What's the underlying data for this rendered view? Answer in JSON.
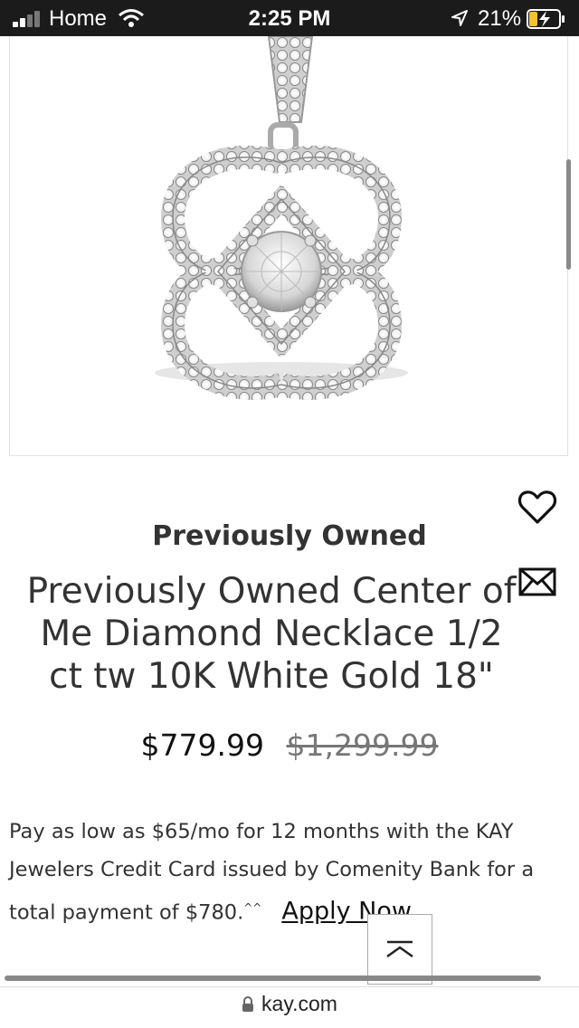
{
  "status_bar": {
    "carrier": "Home",
    "time": "2:25 PM",
    "battery": "21%"
  },
  "product": {
    "brand_label": "Previously Owned",
    "title": "Previously Owned Center of Me Diamond Necklace 1/2 ct tw 10K White Gold 18\"",
    "sale_price": "$779.99",
    "original_price": "$1,299.99",
    "finance_text": "Pay as low as $65/mo for 12 months with the KAY Jewelers Credit Card issued by Comenity Bank for a total payment of $780.",
    "finance_sup": "^^",
    "apply_label": "Apply Now"
  },
  "browser": {
    "url": "kay.com"
  },
  "icons": {
    "wishlist": "heart-icon",
    "email": "envelope-icon",
    "back_to_top": "chevron-up-icon",
    "lock": "lock-icon"
  }
}
